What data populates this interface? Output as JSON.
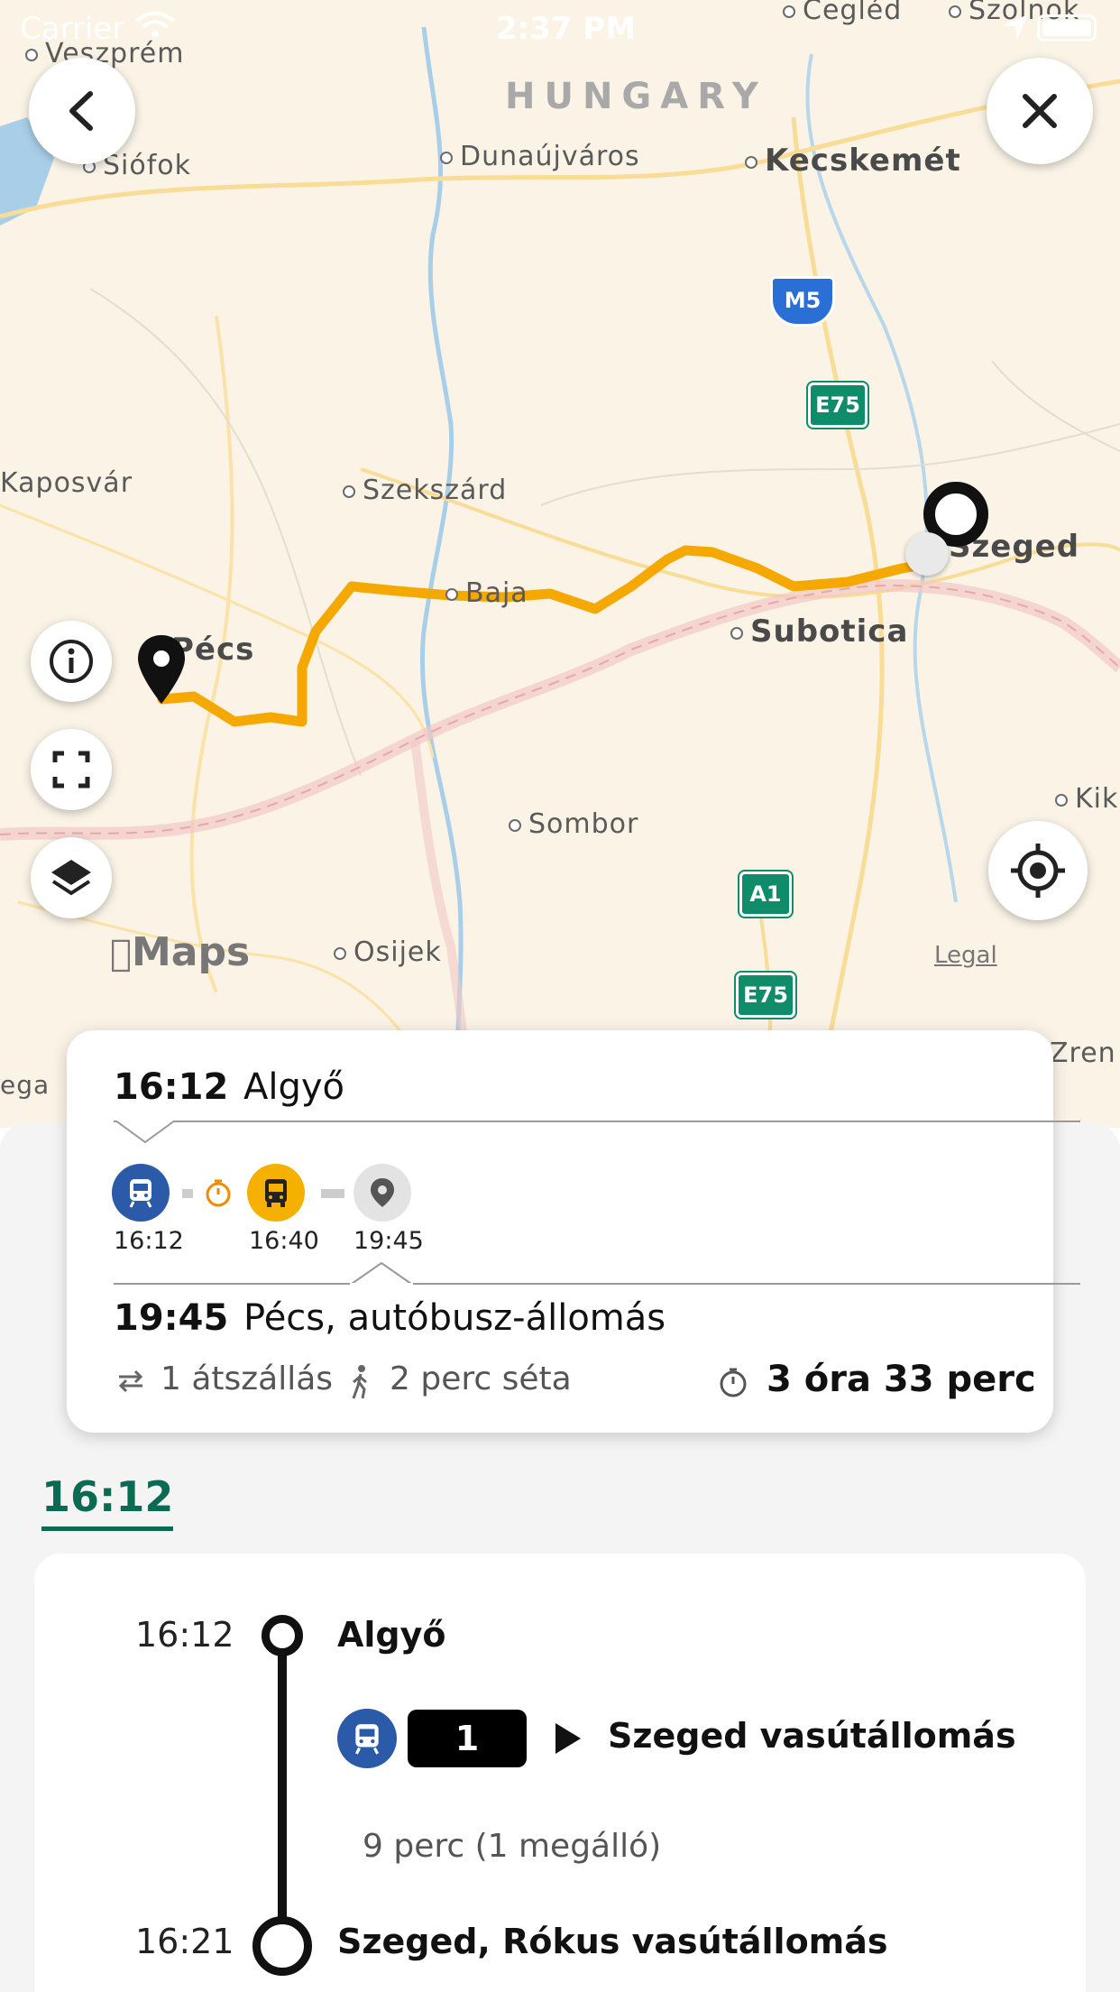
{
  "status_bar": {
    "carrier": "Carrier",
    "time": "2:37 PM"
  },
  "map": {
    "country_label": "HUNGARY",
    "cities": {
      "veszprem": "Veszprém",
      "siofok": "Siófok",
      "dunaujvaros": "Dunaújváros",
      "kecskemet": "Kecskemét",
      "kaposvar": "Kaposvár",
      "szekszard": "Szekszárd",
      "szeged": "Szeged",
      "baja": "Baja",
      "pecs": "Pécs",
      "subotica": "Subotica",
      "sombor": "Sombor",
      "kik": "Kik",
      "osijek": "Osijek",
      "zren": "Zren",
      "ega": "ega",
      "cegled": "Cegléd",
      "szolnok": "Szolnok"
    },
    "road_shields": {
      "m5": "M5",
      "e75_top": "E75",
      "a1": "A1",
      "e75_bottom": "E75"
    },
    "attribution": "Maps",
    "legal": "Legal",
    "route_color": "#f5a800"
  },
  "summary": {
    "departure_time": "16:12",
    "departure_place": "Algyő",
    "legs": [
      {
        "icon": "train-icon",
        "time": "16:12",
        "color": "#2a5aa8"
      },
      {
        "icon": "bus-icon",
        "time": "16:40",
        "color": "#f5b000"
      },
      {
        "icon": "location-pin-icon",
        "time": "19:45",
        "color": "#e3e3e3"
      }
    ],
    "arrival_time": "19:45",
    "arrival_place": "Pécs, autóbusz-állomás",
    "transfers": "1 átszállás",
    "walk": "2 perc séta",
    "duration": "3 óra 33 perc"
  },
  "itinerary": {
    "tab_label": "16:12",
    "stops": [
      {
        "time": "16:12",
        "name": "Algyő"
      },
      {
        "time": "16:21",
        "name": "Szeged, Rókus vasútállomás"
      }
    ],
    "line_number": "1",
    "direction": "Szeged vasútállomás",
    "segment_duration": "9 perc (1 megálló)"
  },
  "colors": {
    "accent_green": "#0b6b52",
    "train_blue": "#2a5aa8",
    "bus_yellow": "#f5b000"
  }
}
